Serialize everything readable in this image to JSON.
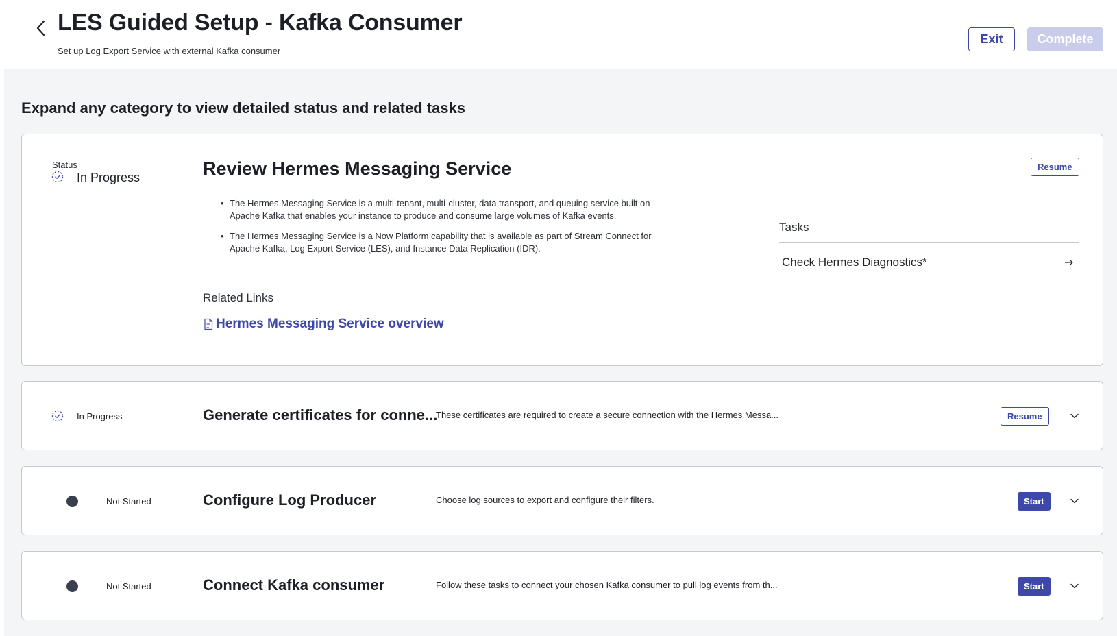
{
  "header": {
    "title": "LES Guided Setup - Kafka Consumer",
    "subtitle": "Set up Log Export Service with external Kafka consumer",
    "exit_label": "Exit",
    "complete_label": "Complete"
  },
  "intro": "Expand any category to view detailed status and related tasks",
  "colors": {
    "accent": "#3d48a8",
    "complete_disabled": "#c9cceb",
    "background": "#f4f5f7",
    "not_started_dot": "#3a3f4d"
  },
  "expanded": {
    "status_label": "Status",
    "status": "In Progress",
    "status_icon": "in-progress-icon",
    "title": "Review Hermes Messaging Service",
    "resume_label": "Resume",
    "bullets": [
      "The Hermes Messaging Service is a multi-tenant, multi-cluster, data transport, and queuing service built on Apache Kafka that enables your instance to produce and consume large volumes of Kafka events.",
      "The Hermes Messaging Service is a Now Platform capability that is available as part of Stream Connect for Apache Kafka, Log Export Service (LES), and Instance Data Replication (IDR)."
    ],
    "related_links_title": "Related Links",
    "related_link": {
      "label": "Hermes Messaging Service overview",
      "icon": "document-icon"
    },
    "tasks_title": "Tasks",
    "tasks": [
      {
        "label": "Check Hermes Diagnostics*",
        "icon": "arrow-right-icon"
      }
    ]
  },
  "rows": [
    {
      "status": "In Progress",
      "status_icon": "in-progress-icon",
      "title": "Generate certificates for conne...",
      "description": "These certificates are required to create a secure connection with the Hermes Messa...",
      "action_label": "Resume",
      "expand_icon": "chevron-down-icon"
    },
    {
      "status": "Not Started",
      "status_icon": "not-started-dot-icon",
      "title": "Configure Log Producer",
      "description": "Choose log sources to export and configure their filters.",
      "action_label": "Start",
      "expand_icon": "chevron-down-icon"
    },
    {
      "status": "Not Started",
      "status_icon": "not-started-dot-icon",
      "title": "Connect Kafka consumer",
      "description": "Follow these tasks to connect your chosen Kafka consumer to pull log events from th...",
      "action_label": "Start",
      "expand_icon": "chevron-down-icon"
    }
  ]
}
